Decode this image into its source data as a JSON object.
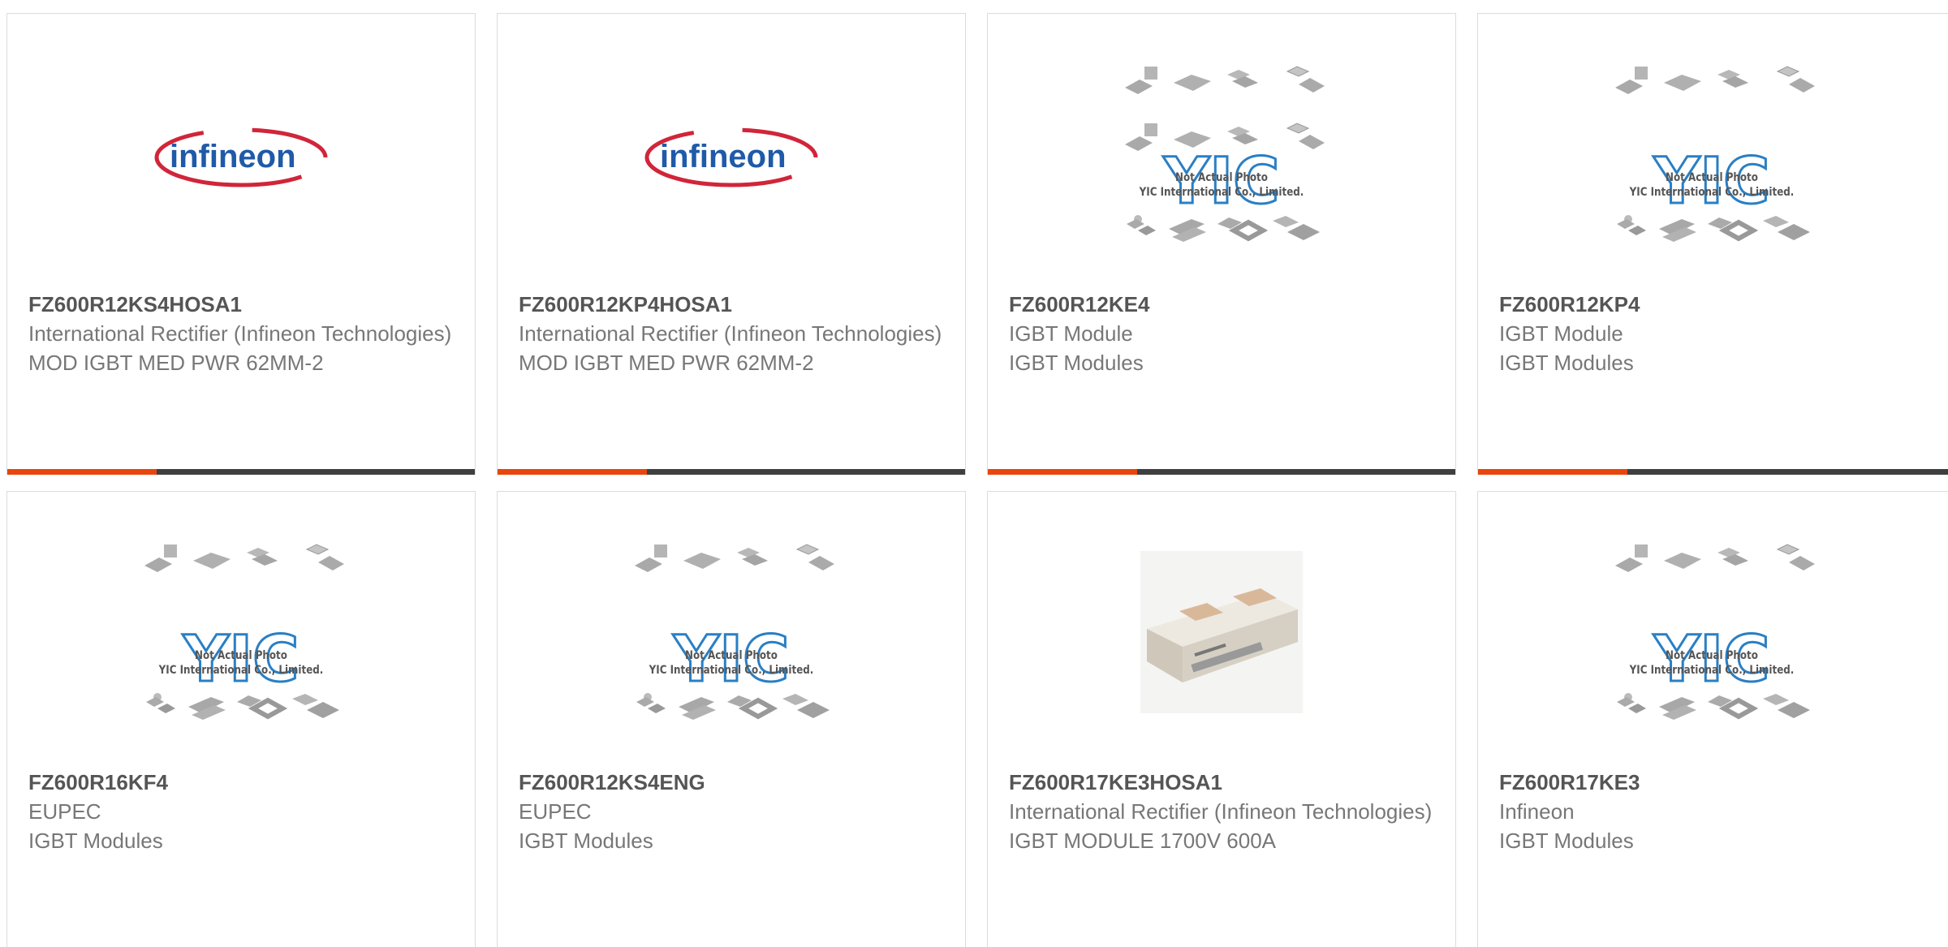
{
  "accent_color": "#e8460e",
  "bar_color": "#3f3f3f",
  "placeholder_text": {
    "line1": "Not Actual Photo",
    "line2": "YIC International Co., Limited.",
    "logo_text": "YIC"
  },
  "infineon_logo_text": "infineon",
  "products": [
    {
      "part": "FZ600R12KS4HOSA1",
      "manufacturer": "International Rectifier (Infineon Technologies)",
      "description": "MOD IGBT MED PWR 62MM-2",
      "image": "infineon-logo"
    },
    {
      "part": "FZ600R12KP4HOSA1",
      "manufacturer": "International Rectifier (Infineon Technologies)",
      "description": "MOD IGBT MED PWR 62MM-2",
      "image": "infineon-logo"
    },
    {
      "part": "FZ600R12KE4",
      "manufacturer": "IGBT Module",
      "description": "IGBT Modules",
      "image": "placeholder"
    },
    {
      "part": "FZ600R12KP4",
      "manufacturer": "IGBT Module",
      "description": "IGBT Modules",
      "image": "placeholder"
    },
    {
      "part": "FZ600R16KF4",
      "manufacturer": "EUPEC",
      "description": "IGBT Modules",
      "image": "placeholder"
    },
    {
      "part": "FZ600R12KS4ENG",
      "manufacturer": "EUPEC",
      "description": "IGBT Modules",
      "image": "placeholder"
    },
    {
      "part": "FZ600R17KE3HOSA1",
      "manufacturer": "International Rectifier (Infineon Technologies)",
      "description": "IGBT MODULE 1700V 600A",
      "image": "module-photo"
    },
    {
      "part": "FZ600R17KE3",
      "manufacturer": "Infineon",
      "description": "IGBT Modules",
      "image": "placeholder"
    }
  ]
}
